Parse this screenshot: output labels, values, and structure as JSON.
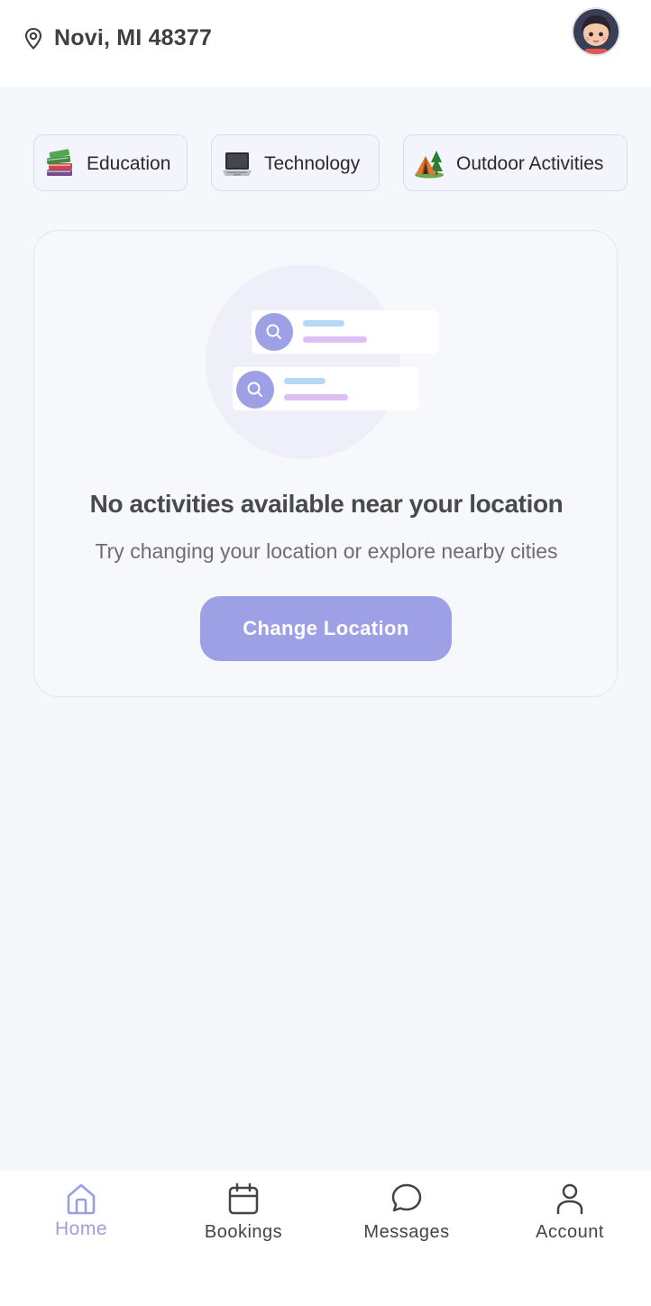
{
  "header": {
    "location": "Novi, MI 48377",
    "location_icon": "map-pin-icon",
    "avatar_icon": "user-avatar"
  },
  "categories": [
    {
      "label": "Education",
      "icon": "books-icon"
    },
    {
      "label": "Technology",
      "icon": "laptop-icon"
    },
    {
      "label": "Outdoor Activities",
      "icon": "tent-icon"
    }
  ],
  "empty_state": {
    "title": "No activities available near your location",
    "subtitle": "Try changing your location or explore nearby cities",
    "button_label": "Change Location",
    "illustration": "search-results-illustration"
  },
  "nav": {
    "items": [
      {
        "label": "Home",
        "icon": "home-icon",
        "active": true
      },
      {
        "label": "Bookings",
        "icon": "calendar-icon",
        "active": false
      },
      {
        "label": "Messages",
        "icon": "chat-bubble-icon",
        "active": false
      },
      {
        "label": "Account",
        "icon": "person-icon",
        "active": false
      }
    ]
  },
  "colors": {
    "accent": "#9da0e4",
    "background": "#f5f8fb",
    "chip_background": "#f3f4fc",
    "title_text": "#4a4a4a"
  }
}
